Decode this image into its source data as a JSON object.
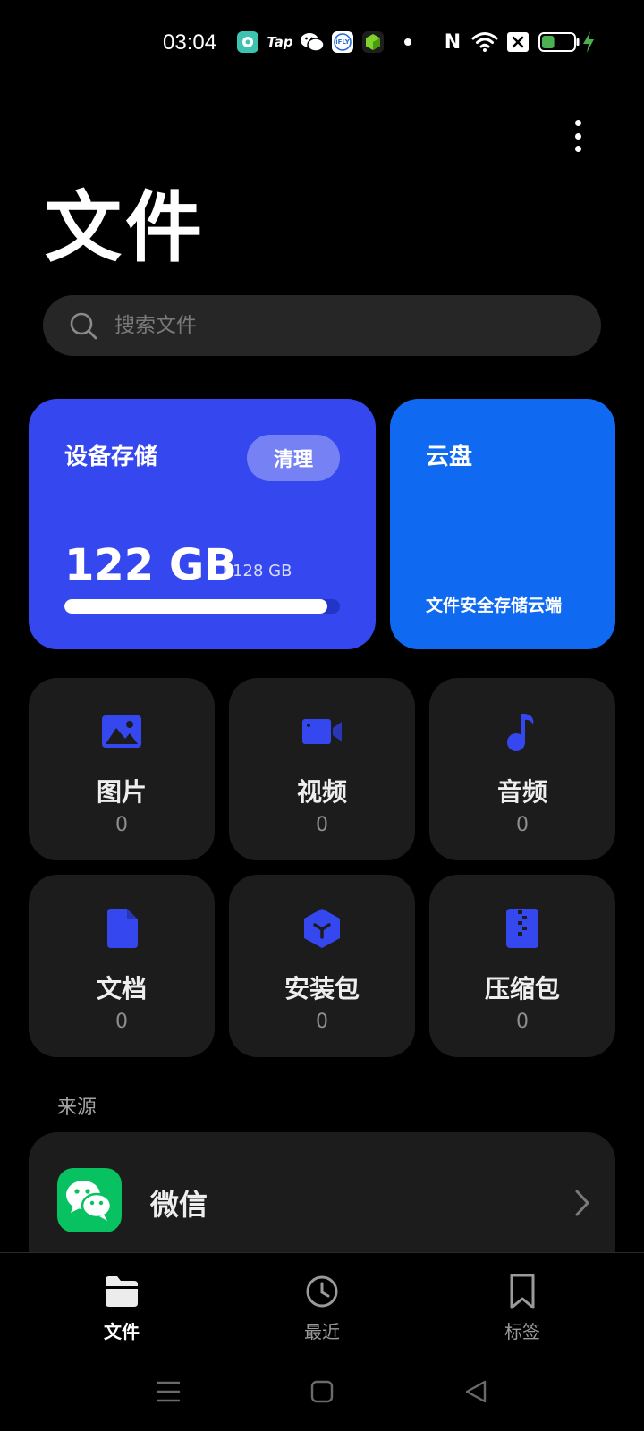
{
  "status_bar": {
    "time": "03:04",
    "tap_label": "Tap",
    "ifly_label": "iFLY",
    "nfc_label": "N",
    "battery_level": 0.4
  },
  "page": {
    "title": "文件",
    "more_icon": "more-vertical-icon"
  },
  "search": {
    "placeholder": "搜索文件",
    "icon": "search-icon"
  },
  "storage": {
    "title": "设备存储",
    "clean_label": "清理",
    "used": "122 GB",
    "total": "128 GB",
    "used_fraction": 0.953
  },
  "cloud": {
    "title": "云盘",
    "subtitle": "文件安全存储云端"
  },
  "categories": [
    {
      "label": "图片",
      "count": "0",
      "icon": "image-icon"
    },
    {
      "label": "视频",
      "count": "0",
      "icon": "video-icon"
    },
    {
      "label": "音频",
      "count": "0",
      "icon": "music-note-icon"
    },
    {
      "label": "文档",
      "count": "0",
      "icon": "document-icon"
    },
    {
      "label": "安装包",
      "count": "0",
      "icon": "package-icon"
    },
    {
      "label": "压缩包",
      "count": "0",
      "icon": "zip-icon"
    }
  ],
  "sources": {
    "header": "来源",
    "items": [
      {
        "label": "微信",
        "icon": "wechat-icon"
      }
    ]
  },
  "bottom_nav": [
    {
      "label": "文件",
      "icon": "folder-icon",
      "active": true
    },
    {
      "label": "最近",
      "icon": "clock-icon",
      "active": false
    },
    {
      "label": "标签",
      "icon": "bookmark-icon",
      "active": false
    }
  ],
  "colors": {
    "accent_blue": "#3547ee",
    "cloud_blue": "#0f6af1",
    "tile_bg": "#1c1c1c",
    "wechat_green": "#08c160",
    "battery_green": "#4caf50"
  }
}
